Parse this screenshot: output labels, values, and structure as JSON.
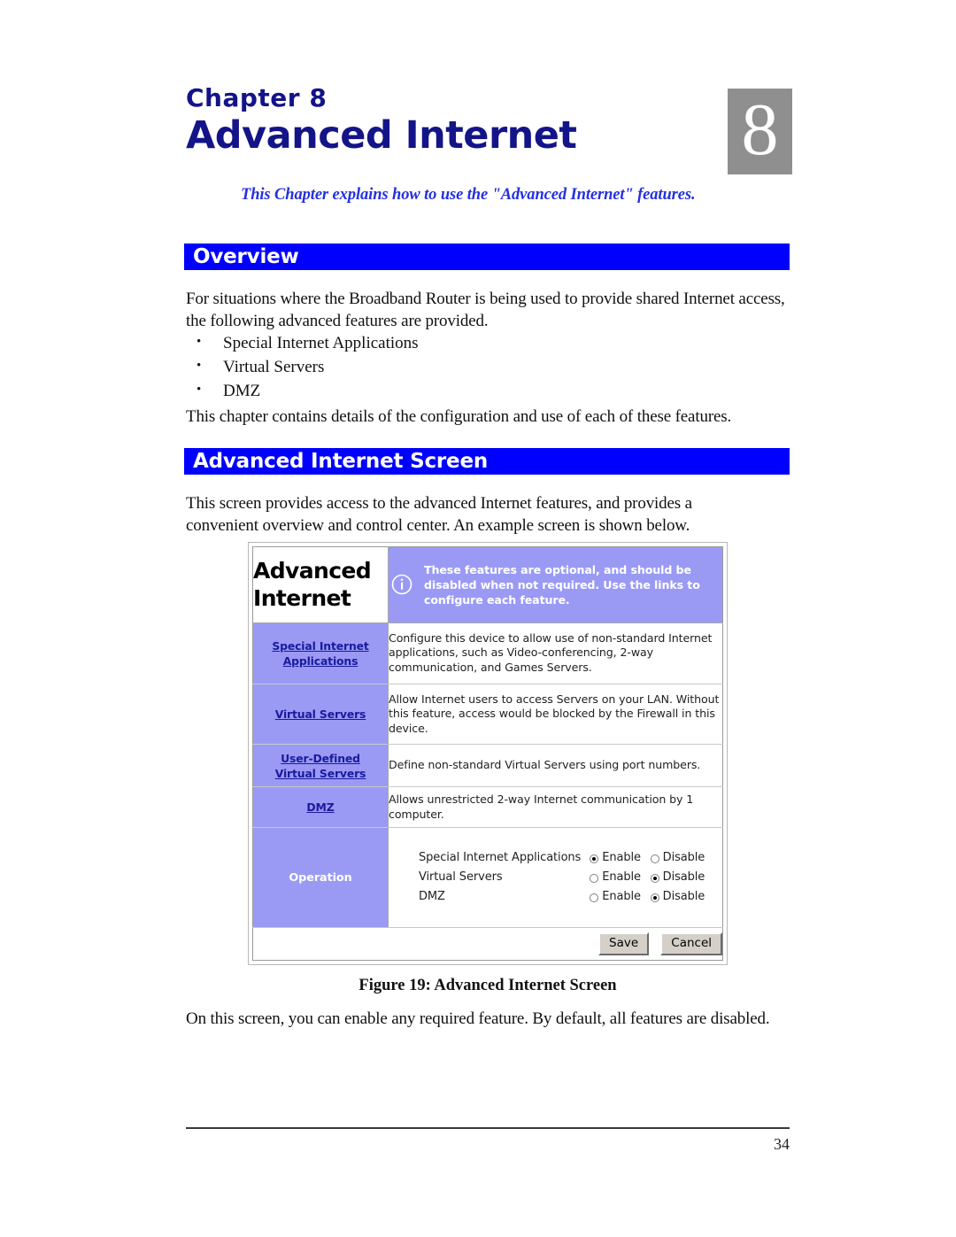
{
  "chapter": {
    "label": "Chapter 8",
    "title": "Advanced Internet",
    "number_badge": "8",
    "intro": "This Chapter explains how to use the  \"Advanced Internet\" features."
  },
  "sections": {
    "overview": {
      "heading": "Overview",
      "paragraph": "For situations where the Broadband Router is being used to provide shared Internet access, the following advanced features are provided.",
      "bullets": [
        "Special Internet Applications",
        "Virtual Servers",
        "DMZ"
      ],
      "closing": "This chapter contains details of the configuration and use of each of these features."
    },
    "advanced_internet_screen": {
      "heading": "Advanced Internet Screen",
      "paragraph": "This screen provides access to the advanced Internet features, and provides a convenient overview and control center. An example screen is shown below.",
      "caption": "Figure 19: Advanced Internet Screen",
      "closing": "On this screen, you can enable any required feature. By default, all features are disabled."
    }
  },
  "figure": {
    "title_line1": "Advanced",
    "title_line2": "Internet",
    "info_icon": "info-circle-icon",
    "banner_text": "These features are optional, and should be disabled when not required. Use the links to configure each feature.",
    "rows": [
      {
        "link_line1": "Special Internet",
        "link_line2": "Applications",
        "description": "Configure this device to allow use of non-standard Internet applications, such as Video-conferencing, 2-way communication, and Games Servers."
      },
      {
        "link_line1": "Virtual Servers",
        "link_line2": "",
        "description": "Allow Internet users to access Servers on your LAN. Without this feature, access would be blocked by the Firewall in this device."
      },
      {
        "link_line1": "User-Defined",
        "link_line2": "Virtual Servers",
        "description": "Define non-standard Virtual Servers using port numbers."
      },
      {
        "link_line1": "DMZ",
        "link_line2": "",
        "description": "Allows unrestricted 2-way Internet communication by 1 computer."
      }
    ],
    "operation": {
      "label": "Operation",
      "enable_label": "Enable",
      "disable_label": "Disable",
      "items": [
        {
          "label": "Special Internet Applications",
          "selected": "Enable"
        },
        {
          "label": "Virtual Servers",
          "selected": "Disable"
        },
        {
          "label": "DMZ",
          "selected": "Disable"
        }
      ]
    },
    "buttons": {
      "save": "Save",
      "cancel": "Cancel"
    },
    "colors": {
      "panel_purple": "#9a9af5",
      "link_blue": "#1a1a9e",
      "button_face": "#d4d0c8"
    }
  },
  "footer": {
    "page_number": "34"
  },
  "theme": {
    "heading_bar": "#0000ff",
    "heading_text": "#ffffff",
    "chapter_title": "#141489",
    "intro_text": "#2430e0",
    "badge_bg": "#8f8f8f"
  }
}
